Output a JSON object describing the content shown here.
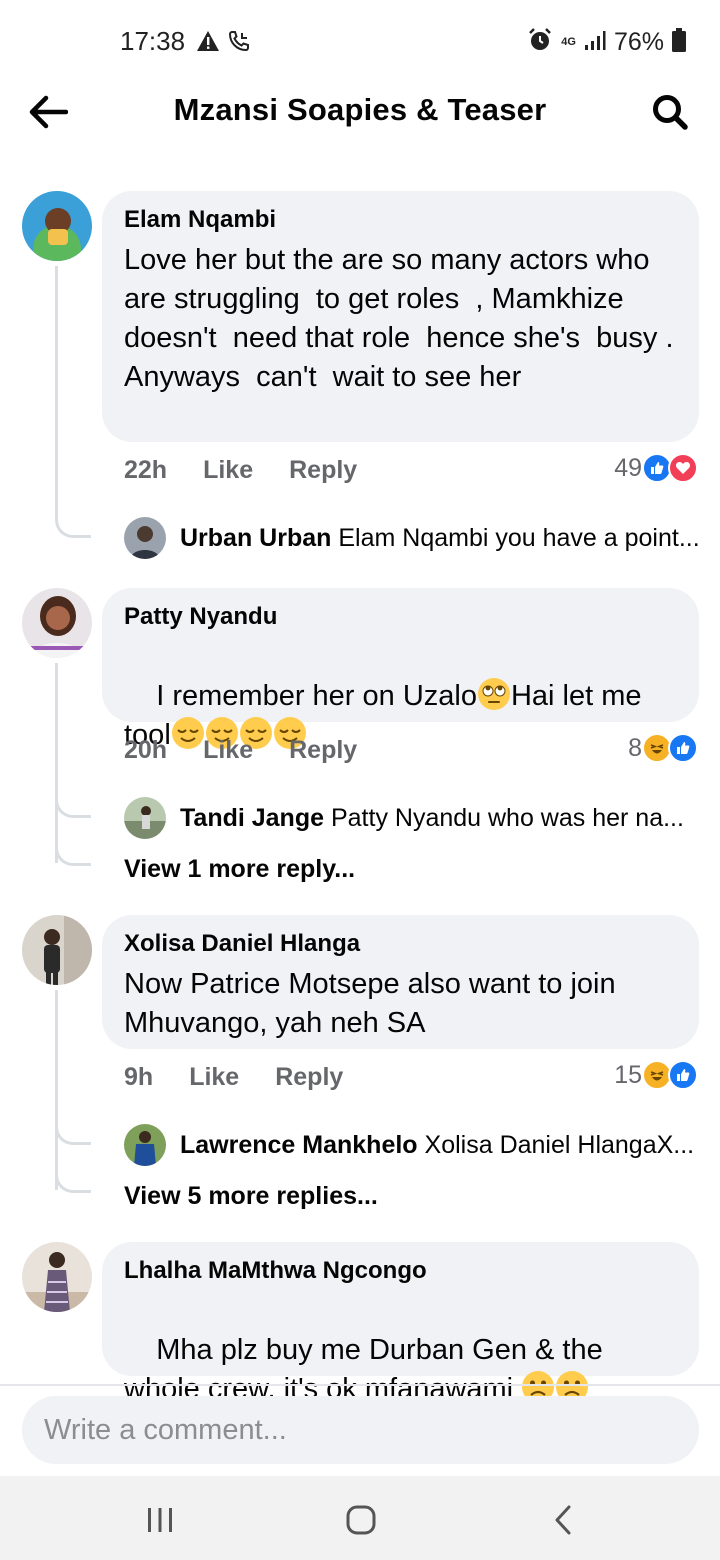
{
  "status_bar": {
    "time": "17:38",
    "network": "4G",
    "battery": "76%"
  },
  "header": {
    "title": "Mzansi Soapies & Teaser"
  },
  "comments": [
    {
      "author": "Elam Nqambi",
      "text": "Love her but the are so many actors who are struggling  to get roles  , Mamkhize doesn't  need that role  hence she's  busy . Anyways  can't  wait to see her",
      "time": "22h",
      "like": "Like",
      "reply": "Reply",
      "reaction_count": "49",
      "reactions": [
        "like-icon",
        "love-icon"
      ],
      "replies": [
        {
          "author": "Urban Urban",
          "text": "Elam Nqambi you have a point..."
        }
      ]
    },
    {
      "author": "Patty Nyandu",
      "text_parts": [
        "I remember her on Uzalo",
        "Hai let me tool"
      ],
      "emojis": [
        "face-with-rolling-eyes",
        "relieved-face",
        "relieved-face",
        "relieved-face",
        "relieved-face"
      ],
      "time": "20h",
      "like": "Like",
      "reply": "Reply",
      "reaction_count": "8",
      "reactions": [
        "haha-icon",
        "like-icon"
      ],
      "replies": [
        {
          "author": "Tandi Jange",
          "text": "Patty Nyandu who was her na..."
        }
      ],
      "more_replies": "View 1 more reply..."
    },
    {
      "author": "Xolisa Daniel Hlanga",
      "text": "Now Patrice Motsepe also want to join Mhuvango, yah neh SA",
      "time": "9h",
      "like": "Like",
      "reply": "Reply",
      "reaction_count": "15",
      "reactions": [
        "haha-icon",
        "like-icon"
      ],
      "replies": [
        {
          "author": "Lawrence Mankhelo",
          "text": "Xolisa Daniel HlangaX..."
        }
      ],
      "more_replies": "View 5 more replies..."
    },
    {
      "author": "Lhalha MaMthwa Ngcongo",
      "text": "Mha plz buy me Durban Gen & the whole crew, it's ok mfanawami",
      "emojis": [
        "frowning-face",
        "frowning-face"
      ]
    }
  ],
  "composer": {
    "placeholder": "Write a comment..."
  },
  "colors": {
    "bubble": "#f0f2f5",
    "meta_text": "#65676b",
    "like_blue": "#1877f2",
    "love_red": "#f33e58",
    "haha_yellow": "#f7b125"
  }
}
